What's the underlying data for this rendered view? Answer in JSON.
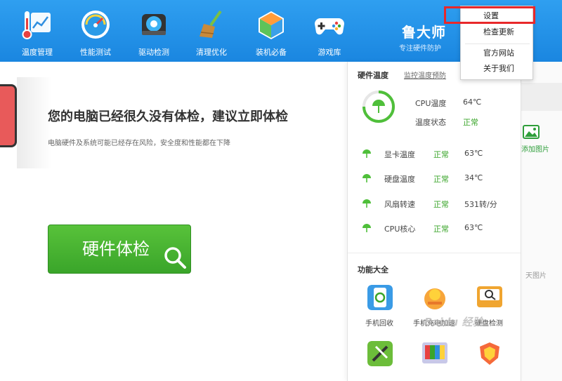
{
  "nav": {
    "items": [
      {
        "label": "温度管理",
        "icon": "thermometer-chart-icon"
      },
      {
        "label": "性能测试",
        "icon": "speedometer-icon"
      },
      {
        "label": "驱动检测",
        "icon": "gear-icon"
      },
      {
        "label": "清理优化",
        "icon": "broom-icon"
      },
      {
        "label": "装机必备",
        "icon": "cube-icon"
      },
      {
        "label": "游戏库",
        "icon": "gamepad-icon"
      }
    ],
    "brand_title": "鲁大师",
    "brand_subtitle": "专注硬件防护"
  },
  "main": {
    "headline": "您的电脑已经很久没有体检，建议立即体检",
    "subline": "电脑硬件及系统可能已经存在风险，安全度和性能都在下降",
    "check_button": "硬件体检"
  },
  "hardware": {
    "title": "硬件温度",
    "link": "监控温度预防",
    "cpu_temp_label": "CPU温度",
    "cpu_temp_value": "64℃",
    "temp_status_label": "温度状态",
    "temp_status_value": "正常",
    "rows": [
      {
        "label": "显卡温度",
        "status": "正常",
        "value": "63℃"
      },
      {
        "label": "硬盘温度",
        "status": "正常",
        "value": "34℃"
      },
      {
        "label": "风扇转速",
        "status": "正常",
        "value": "531转/分"
      },
      {
        "label": "CPU核心",
        "status": "正常",
        "value": "63℃"
      }
    ]
  },
  "functions": {
    "title": "功能大全",
    "items": [
      {
        "label": "手机回收",
        "icon": "phone-recycle-icon"
      },
      {
        "label": "手机充电加速",
        "icon": "charge-boost-icon"
      },
      {
        "label": "硬盘检测",
        "icon": "disk-check-icon"
      },
      {
        "label": "",
        "icon": "tool-icon"
      },
      {
        "label": "",
        "icon": "screen-test-icon"
      },
      {
        "label": "",
        "icon": "shield-icon"
      }
    ]
  },
  "menu": {
    "items": [
      "设置",
      "检查更新",
      "官方网站",
      "关于我们"
    ]
  },
  "right_partial": {
    "add_image_label": "添加图片",
    "text": "天图片"
  },
  "watermark": "Baidu 经验",
  "colors": {
    "topbar": "#2a96ec",
    "primary_green": "#3aa52a",
    "highlight_red": "#e8282a"
  }
}
